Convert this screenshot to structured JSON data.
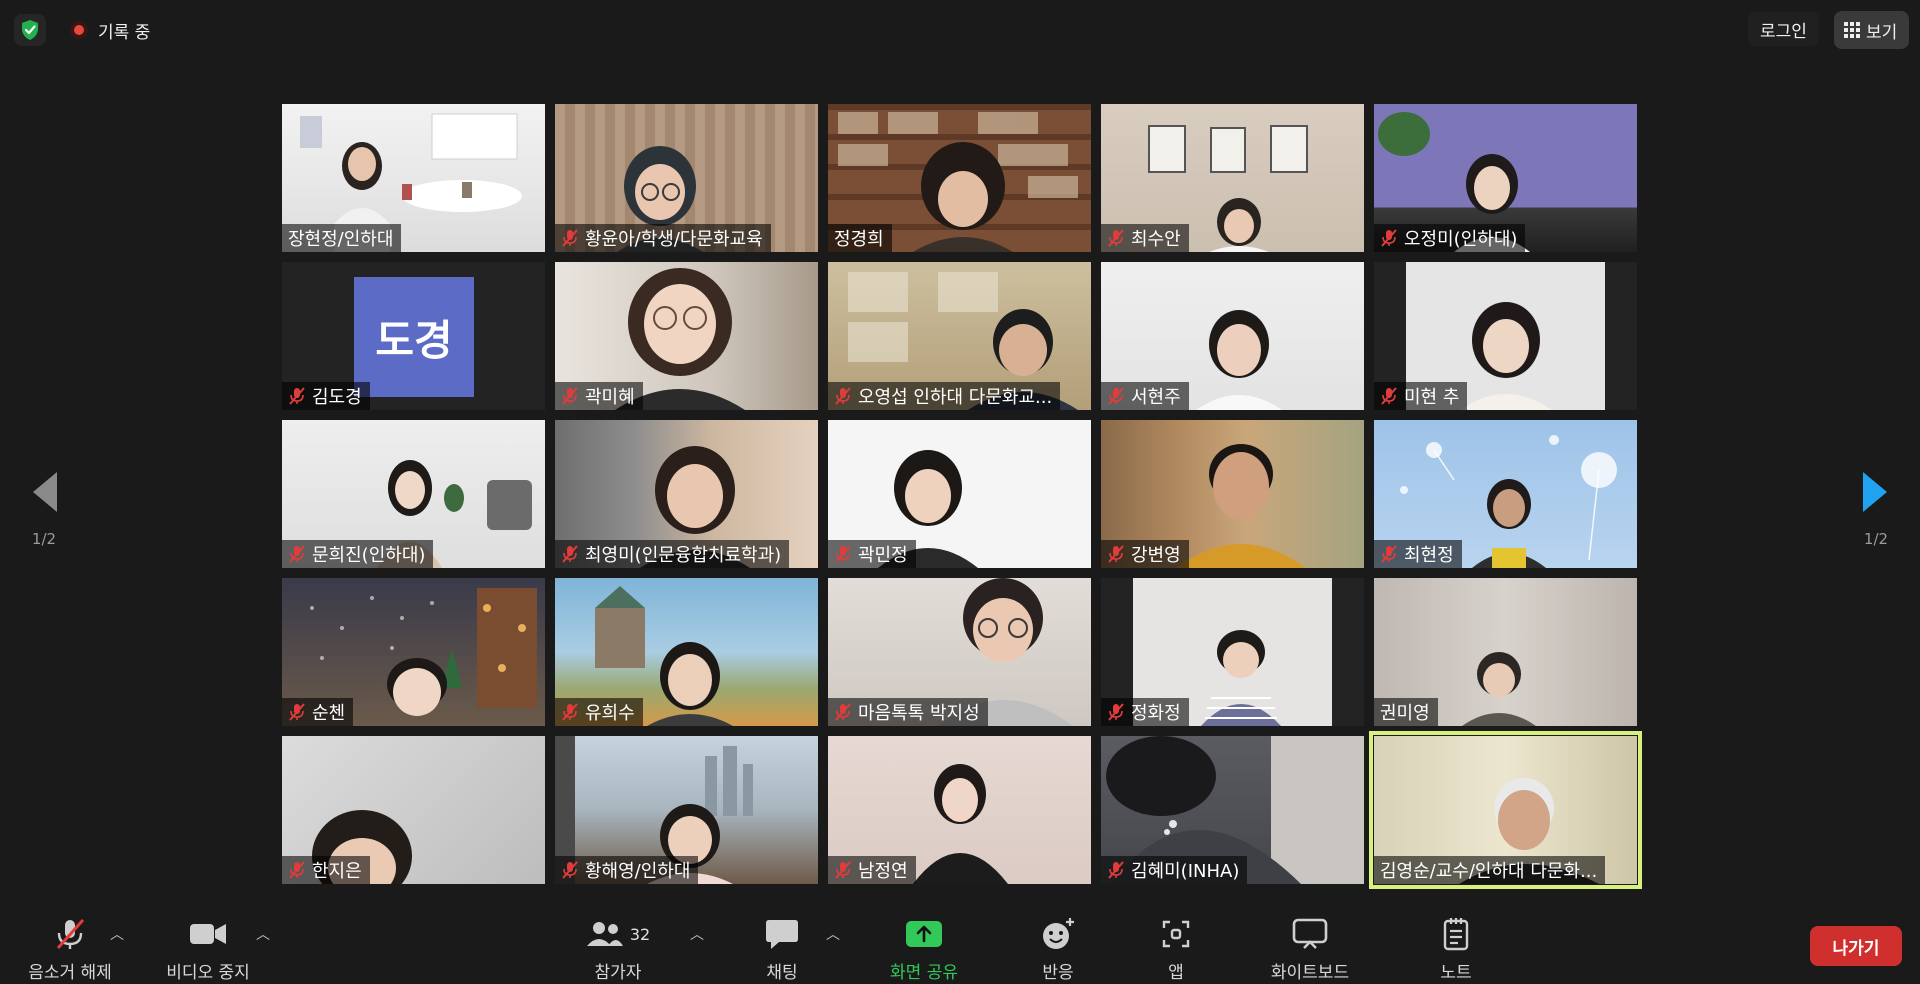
{
  "topbar": {
    "recording_label": "기록 중",
    "login_label": "로그인",
    "view_label": "보기"
  },
  "pagination": {
    "page_label": "1/2"
  },
  "participants": [
    {
      "name": "장현정/인하대",
      "muted": false
    },
    {
      "name": "황윤아/학생/다문화교육",
      "muted": true
    },
    {
      "name": "정경희",
      "muted": false
    },
    {
      "name": "최수안",
      "muted": true
    },
    {
      "name": "오정미(인하대)",
      "muted": true
    },
    {
      "name": "김도경",
      "muted": true,
      "avatar_text": "도경"
    },
    {
      "name": "곽미혜",
      "muted": true
    },
    {
      "name": "오영섭 인하대 다문화교...",
      "muted": true
    },
    {
      "name": "서현주",
      "muted": true
    },
    {
      "name": "미현 추",
      "muted": true
    },
    {
      "name": "문희진(인하대)",
      "muted": true
    },
    {
      "name": "최영미(인문융합치료학과)",
      "muted": true
    },
    {
      "name": "곽민정",
      "muted": true
    },
    {
      "name": "강변영",
      "muted": true
    },
    {
      "name": "최현정",
      "muted": true
    },
    {
      "name": "순첸",
      "muted": true
    },
    {
      "name": "유희수",
      "muted": true
    },
    {
      "name": "마음톡톡 박지성",
      "muted": true
    },
    {
      "name": "정화정",
      "muted": true
    },
    {
      "name": "권미영",
      "muted": false
    },
    {
      "name": "한지은",
      "muted": true
    },
    {
      "name": "황해영/인하대",
      "muted": true
    },
    {
      "name": "남정연",
      "muted": true
    },
    {
      "name": "김혜미(INHA)",
      "muted": true
    },
    {
      "name": "김영순/교수/인하대 다문화...",
      "muted": false,
      "active_speaker": true
    }
  ],
  "toolbar": {
    "unmute_label": "음소거 해제",
    "stop_video_label": "비디오 중지",
    "participants_label": "참가자",
    "participants_count": "32",
    "chat_label": "채팅",
    "share_label": "화면 공유",
    "reactions_label": "반응",
    "apps_label": "앱",
    "whiteboard_label": "화이트보드",
    "notes_label": "노트",
    "leave_label": "나가기"
  },
  "colors": {
    "background": "#1a1a1a",
    "share_green": "#32c85a",
    "leave_red": "#d0302d",
    "active_speaker": "#d7f07e",
    "nav_arrow_next": "#1fa3f0",
    "nav_arrow_prev": "#8a8a8a"
  }
}
